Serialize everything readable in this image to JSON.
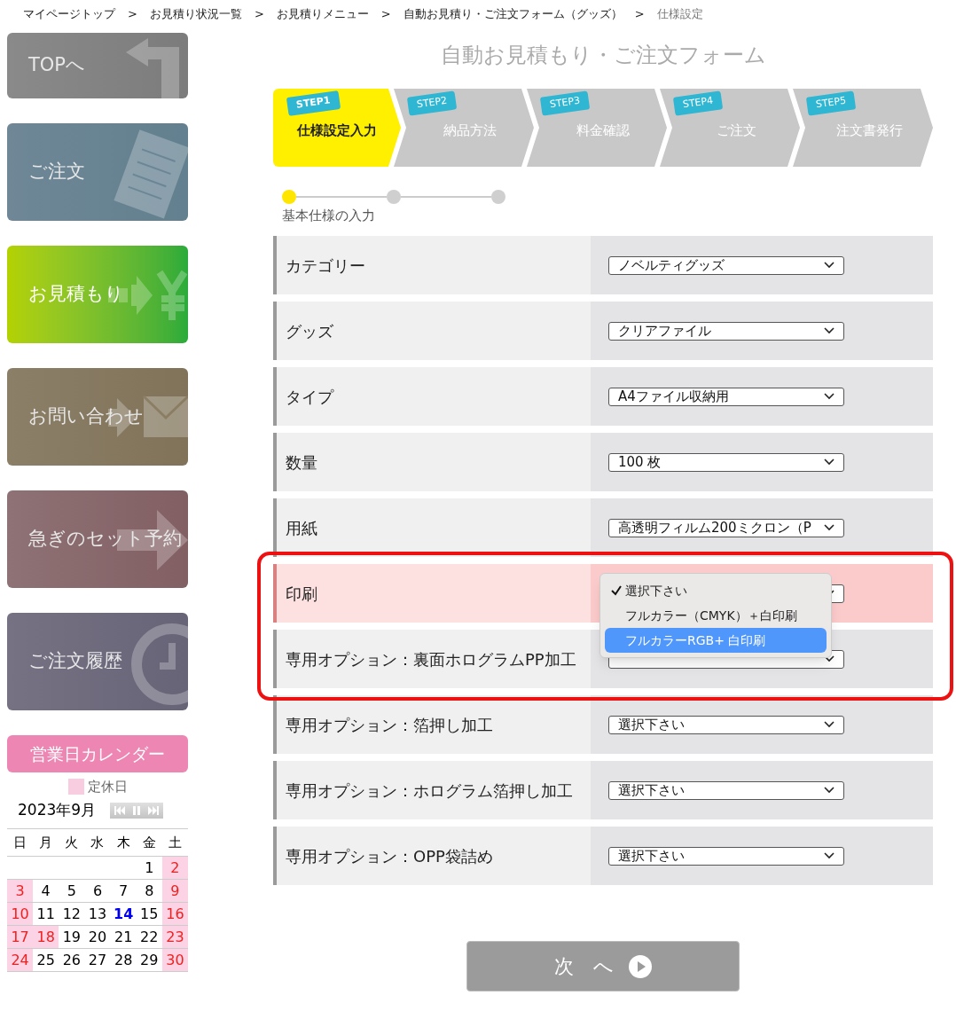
{
  "breadcrumb": {
    "separator": ">",
    "items": [
      {
        "label": "マイページトップ",
        "current": false
      },
      {
        "label": "お見積り状況一覧",
        "current": false
      },
      {
        "label": "お見積りメニュー",
        "current": false
      },
      {
        "label": "自動お見積り・ご注文フォーム（グッズ）",
        "current": false
      },
      {
        "label": "仕様設定",
        "current": true
      }
    ]
  },
  "sidebar": {
    "items": [
      {
        "kind": "top",
        "label": "TOPへ",
        "selected": false
      },
      {
        "kind": "order",
        "label": "ご注文",
        "selected": false
      },
      {
        "kind": "estimate",
        "label": "お見積もり",
        "selected": true
      },
      {
        "kind": "contact",
        "label": "お問い合わせ",
        "selected": false
      },
      {
        "kind": "rush",
        "label": "急ぎのセット予約",
        "selected": false
      },
      {
        "kind": "history",
        "label": "ご注文履歴",
        "selected": false
      }
    ]
  },
  "calendar": {
    "title": "営業日カレンダー",
    "legend": "定休日",
    "month": "2023年9月",
    "weekdays": [
      "日",
      "月",
      "火",
      "水",
      "木",
      "金",
      "土"
    ],
    "weeks": [
      [
        {
          "kind": "blank"
        },
        {
          "kind": "blank"
        },
        {
          "kind": "blank"
        },
        {
          "kind": "blank"
        },
        {
          "kind": "blank"
        },
        {
          "kind": "day",
          "day": "1",
          "holiday": false,
          "today": false
        },
        {
          "kind": "day",
          "day": "2",
          "holiday": true,
          "today": false
        }
      ],
      [
        {
          "kind": "day",
          "day": "3",
          "holiday": true,
          "today": false
        },
        {
          "kind": "day",
          "day": "4",
          "holiday": false,
          "today": false
        },
        {
          "kind": "day",
          "day": "5",
          "holiday": false,
          "today": false
        },
        {
          "kind": "day",
          "day": "6",
          "holiday": false,
          "today": false
        },
        {
          "kind": "day",
          "day": "7",
          "holiday": false,
          "today": false
        },
        {
          "kind": "day",
          "day": "8",
          "holiday": false,
          "today": false
        },
        {
          "kind": "day",
          "day": "9",
          "holiday": true,
          "today": false
        }
      ],
      [
        {
          "kind": "day",
          "day": "10",
          "holiday": true,
          "today": false
        },
        {
          "kind": "day",
          "day": "11",
          "holiday": false,
          "today": false
        },
        {
          "kind": "day",
          "day": "12",
          "holiday": false,
          "today": false
        },
        {
          "kind": "day",
          "day": "13",
          "holiday": false,
          "today": false
        },
        {
          "kind": "day",
          "day": "14",
          "holiday": false,
          "today": true
        },
        {
          "kind": "day",
          "day": "15",
          "holiday": false,
          "today": false
        },
        {
          "kind": "day",
          "day": "16",
          "holiday": true,
          "today": false
        }
      ],
      [
        {
          "kind": "day",
          "day": "17",
          "holiday": true,
          "today": false
        },
        {
          "kind": "day",
          "day": "18",
          "holiday": true,
          "today": false
        },
        {
          "kind": "day",
          "day": "19",
          "holiday": false,
          "today": false
        },
        {
          "kind": "day",
          "day": "20",
          "holiday": false,
          "today": false
        },
        {
          "kind": "day",
          "day": "21",
          "holiday": false,
          "today": false
        },
        {
          "kind": "day",
          "day": "22",
          "holiday": false,
          "today": false
        },
        {
          "kind": "day",
          "day": "23",
          "holiday": true,
          "today": false
        }
      ],
      [
        {
          "kind": "day",
          "day": "24",
          "holiday": true,
          "today": false
        },
        {
          "kind": "day",
          "day": "25",
          "holiday": false,
          "today": false
        },
        {
          "kind": "day",
          "day": "26",
          "holiday": false,
          "today": false
        },
        {
          "kind": "day",
          "day": "27",
          "holiday": false,
          "today": false
        },
        {
          "kind": "day",
          "day": "28",
          "holiday": false,
          "today": false
        },
        {
          "kind": "day",
          "day": "29",
          "holiday": false,
          "today": false
        },
        {
          "kind": "day",
          "day": "30",
          "holiday": true,
          "today": false
        }
      ]
    ]
  },
  "heading": "自動お見積もり・ご注文フォーム",
  "steps": [
    {
      "badge": "STEP1",
      "label": "仕様設定入力",
      "selected": true
    },
    {
      "badge": "STEP2",
      "label": "納品方法",
      "selected": false
    },
    {
      "badge": "STEP3",
      "label": "料金確認",
      "selected": false
    },
    {
      "badge": "STEP4",
      "label": "ご注文",
      "selected": false
    },
    {
      "badge": "STEP5",
      "label": "注文書発行",
      "selected": false
    }
  ],
  "progress": {
    "dots": [
      {
        "selected": true
      },
      {
        "selected": false
      },
      {
        "selected": false
      }
    ],
    "label": "基本仕様の入力"
  },
  "form": {
    "rows": [
      {
        "label": "カテゴリー",
        "value": "ノベルティグッズ",
        "highlighted": false,
        "annotated": false
      },
      {
        "label": "グッズ",
        "value": "クリアファイル",
        "highlighted": false,
        "annotated": false
      },
      {
        "label": "タイプ",
        "value": "A4ファイル収納用",
        "highlighted": false,
        "annotated": false
      },
      {
        "label": "数量",
        "value": "100 枚",
        "highlighted": false,
        "annotated": false
      },
      {
        "label": "用紙",
        "value": "高透明フィルム200ミクロン（P",
        "highlighted": false,
        "annotated": false
      },
      {
        "label": "印刷",
        "highlighted": true,
        "annotated": true,
        "dropdown": {
          "options": [
            {
              "label": "選択下さい",
              "checked": true,
              "highlighted": false
            },
            {
              "label": "フルカラー（CMYK）＋白印刷",
              "checked": false,
              "highlighted": false
            },
            {
              "label": "フルカラーRGB+ 白印刷",
              "checked": false,
              "highlighted": true
            }
          ]
        }
      },
      {
        "label": "専用オプション：裏面ホログラムPP加工",
        "highlighted": false,
        "annotated": true
      },
      {
        "label": "専用オプション：箔押し加工",
        "value": "選択下さい",
        "highlighted": false,
        "annotated": false
      },
      {
        "label": "専用オプション：ホログラム箔押し加工",
        "value": "選択下さい",
        "highlighted": false,
        "annotated": false
      },
      {
        "label": "専用オプション：OPP袋詰め",
        "value": "選択下さい",
        "highlighted": false,
        "annotated": false
      }
    ]
  },
  "next_button": {
    "label": "次　へ",
    "disabled": true
  }
}
